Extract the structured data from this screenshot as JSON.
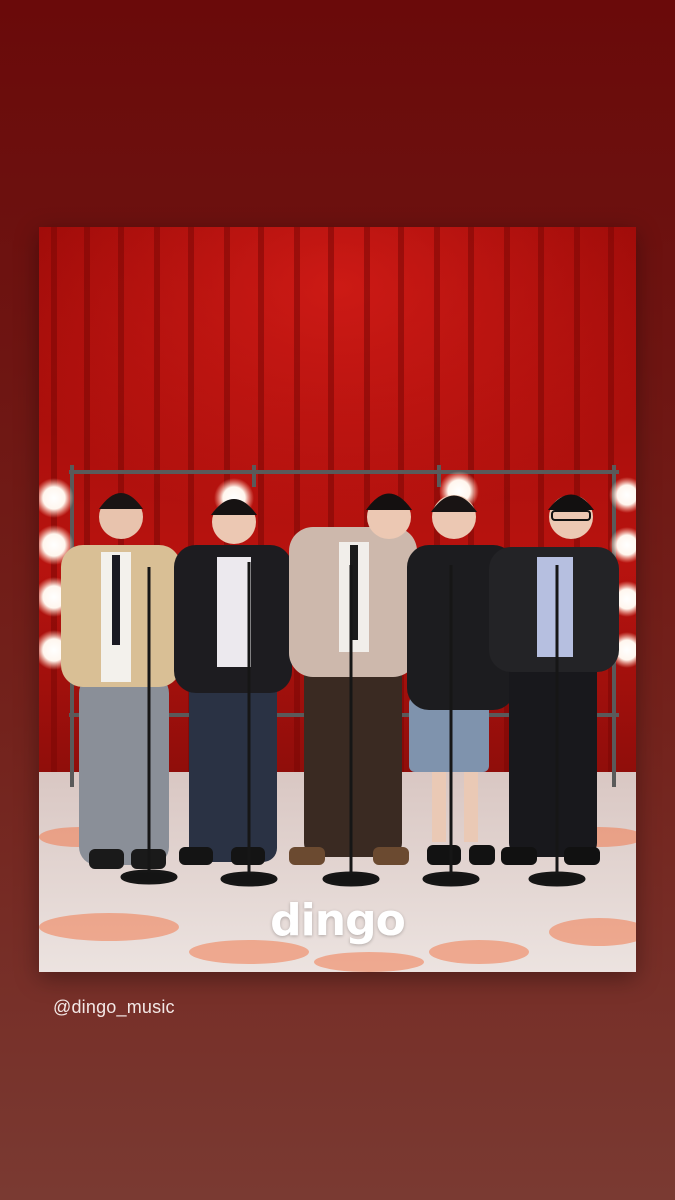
{
  "post": {
    "watermark": "dingo",
    "handle": "@dingo_music"
  },
  "icons": [
    "dingo-logo"
  ],
  "colors": {
    "background_top": "#6a0a0a",
    "background_bottom": "#7a3a32",
    "curtain": "#b5120f",
    "floor": "#e9dedb"
  }
}
